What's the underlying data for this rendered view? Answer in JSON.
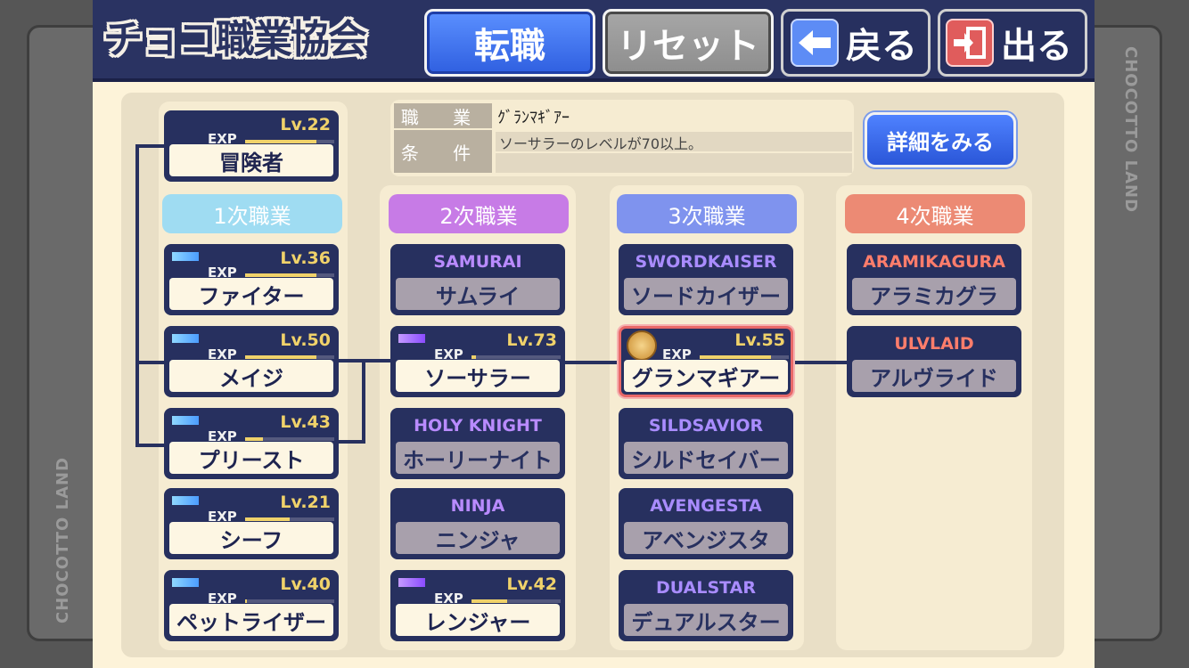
{
  "side_text": "CHOCOTTO LAND",
  "header": {
    "title": "チョコ職業協会",
    "buttons": {
      "change": "転職",
      "reset": "リセット",
      "back": "戻る",
      "exit": "出る"
    }
  },
  "info": {
    "job_label": "職 業",
    "cond_label": "条 件",
    "job_value": "ｸﾞﾗﾝﾏｷﾞｱｰ",
    "cond_value": "ソーサラーのレベルが70以上。",
    "detail_button": "詳細をみる"
  },
  "tiers": [
    "1次職業",
    "2次職業",
    "3次職業",
    "4次職業"
  ],
  "exp_label": "EXP",
  "base_job": {
    "name": "冒険者",
    "level": "Lv.22",
    "exp": 0.8
  },
  "tier1": [
    {
      "name": "ファイター",
      "level": "Lv.36",
      "exp": 0.8
    },
    {
      "name": "メイジ",
      "level": "Lv.50",
      "exp": 0.8
    },
    {
      "name": "プリースト",
      "level": "Lv.43",
      "exp": 0.2
    },
    {
      "name": "シーフ",
      "level": "Lv.21",
      "exp": 0.5
    },
    {
      "name": "ペットライザー",
      "level": "Lv.40",
      "exp": 0.02
    }
  ],
  "tier2": [
    {
      "en": "SAMURAI",
      "name": "サムライ"
    },
    {
      "name": "ソーサラー",
      "level": "Lv.73",
      "exp": 0.05
    },
    {
      "en": "HOLY KNIGHT",
      "name": "ホーリーナイト"
    },
    {
      "en": "NINJA",
      "name": "ニンジャ"
    },
    {
      "name": "レンジャー",
      "level": "Lv.42",
      "exp": 0.4
    }
  ],
  "tier3": [
    {
      "en": "SWORDKAISER",
      "name": "ソードカイザー"
    },
    {
      "name": "グランマギアー",
      "level": "Lv.55",
      "exp": 0.8
    },
    {
      "en": "SILDSAVIOR",
      "name": "シルドセイバー"
    },
    {
      "en": "AVENGESTA",
      "name": "アベンジスタ"
    },
    {
      "en": "DUALSTAR",
      "name": "デュアルスター"
    }
  ],
  "tier4": [
    {
      "en": "ARAMIKAGURA",
      "name": "アラミカグラ"
    },
    {
      "en": "ULVLAID",
      "name": "アルヴライド"
    }
  ]
}
